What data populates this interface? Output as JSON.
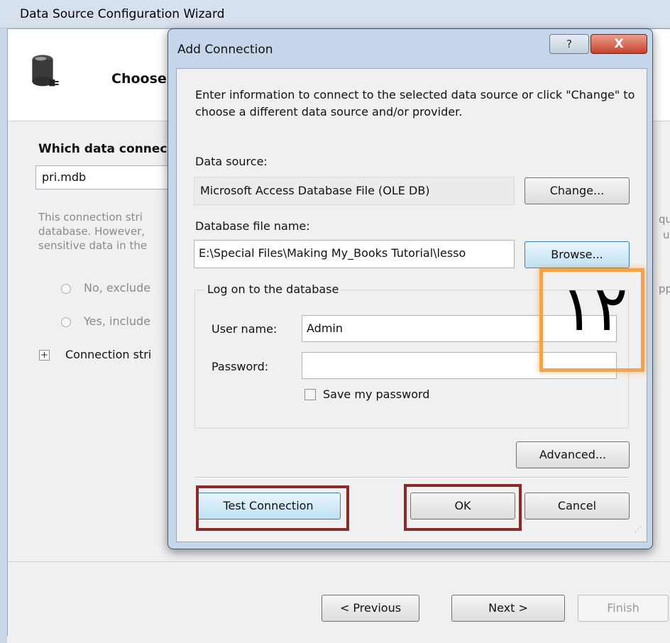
{
  "wizard": {
    "title": "Data Source Configuration Wizard",
    "heading": "Choose",
    "question": "Which data connec",
    "connection_value": "pri.mdb",
    "description": "This connection stri database. However, sensitive data in the",
    "radio_no": "No, exclude",
    "radio_yes": "Yes, include",
    "expander_label": "Connection stri",
    "right_edge_fragments": [
      "qu",
      "u",
      "pp"
    ],
    "buttons": {
      "previous": "< Previous",
      "next": "Next >",
      "finish": "Finish"
    }
  },
  "dialog": {
    "title": "Add Connection",
    "help_label": "?",
    "close_label": "X",
    "intro": "Enter information to connect to the selected data source or click \"Change\" to choose a different data source and/or provider.",
    "data_source_label": "Data source:",
    "data_source_value": "Microsoft Access Database File (OLE DB)",
    "change_label": "Change...",
    "db_file_label": "Database file name:",
    "db_file_value": "E:\\Special Files\\Making My_Books Tutorial\\lesso",
    "browse_label": "Browse...",
    "logon_group_label": "Log on to the database",
    "username_label": "User name:",
    "username_value": "Admin",
    "password_label": "Password:",
    "password_value": "",
    "save_password_label": "Save my password",
    "save_password_checked": false,
    "advanced_label": "Advanced...",
    "test_connection_label": "Test Connection",
    "ok_label": "OK",
    "cancel_label": "Cancel"
  },
  "annotation": {
    "number_text": "١٢"
  },
  "colors": {
    "highlight_red": "#8a2a2a",
    "highlight_orange": "#f4a34a",
    "close_button": "#c7412a",
    "dialog_frame": "#c6d6ea"
  }
}
